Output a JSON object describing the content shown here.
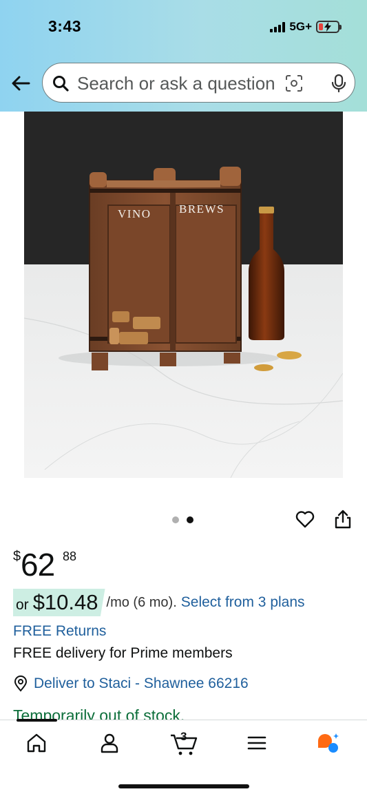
{
  "status_bar": {
    "time": "3:43",
    "network": "5G+"
  },
  "search": {
    "placeholder": "Search or ask a question"
  },
  "product_image": {
    "left_label": "VINO",
    "right_label": "BREWS",
    "dots_total": 2,
    "dots_active_index": 1
  },
  "price": {
    "currency": "$",
    "whole": "62",
    "fraction": "88"
  },
  "monthly": {
    "or": "or",
    "amount": "$10.48",
    "term": "/mo (6 mo).",
    "plans_link": "Select from 3 plans"
  },
  "returns": "FREE Returns",
  "delivery": "FREE delivery for Prime members",
  "location": "Deliver to Staci - Shawnee 66216",
  "stock": "Temporarily out of stock.",
  "bottom_nav": {
    "cart_count": "3"
  },
  "colors": {
    "link": "#1f5f9c",
    "highlight": "#cdeee3",
    "stock": "#0c6e3a",
    "rufus": "#ff6a13"
  }
}
